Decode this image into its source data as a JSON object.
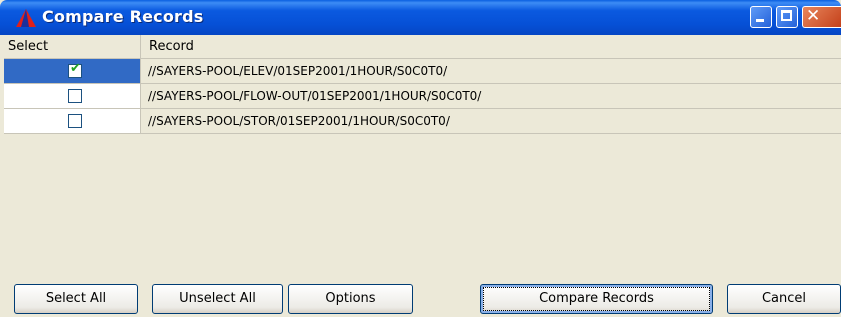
{
  "window": {
    "title": "Compare Records",
    "colors": {
      "titlebar": "#0650d6",
      "selection": "#316ac5",
      "close_button": "#c4401a",
      "background": "#ece9d8"
    }
  },
  "table": {
    "columns": [
      "Select",
      "Record"
    ],
    "rows": [
      {
        "selected": true,
        "record": "//SAYERS-POOL/ELEV/01SEP2001/1HOUR/S0C0T0/"
      },
      {
        "selected": false,
        "record": "//SAYERS-POOL/FLOW-OUT/01SEP2001/1HOUR/S0C0T0/"
      },
      {
        "selected": false,
        "record": "//SAYERS-POOL/STOR/01SEP2001/1HOUR/S0C0T0/"
      }
    ]
  },
  "buttons": {
    "select_all": "Select All",
    "unselect_all": "Unselect All",
    "options": "Options",
    "compare_records": "Compare Records",
    "cancel": "Cancel"
  },
  "icons": {
    "app": "red-blue-triangle-icon",
    "minimize": "minimize-icon",
    "maximize": "maximize-icon",
    "close": "close-icon",
    "checkmark": "checkmark-icon"
  }
}
